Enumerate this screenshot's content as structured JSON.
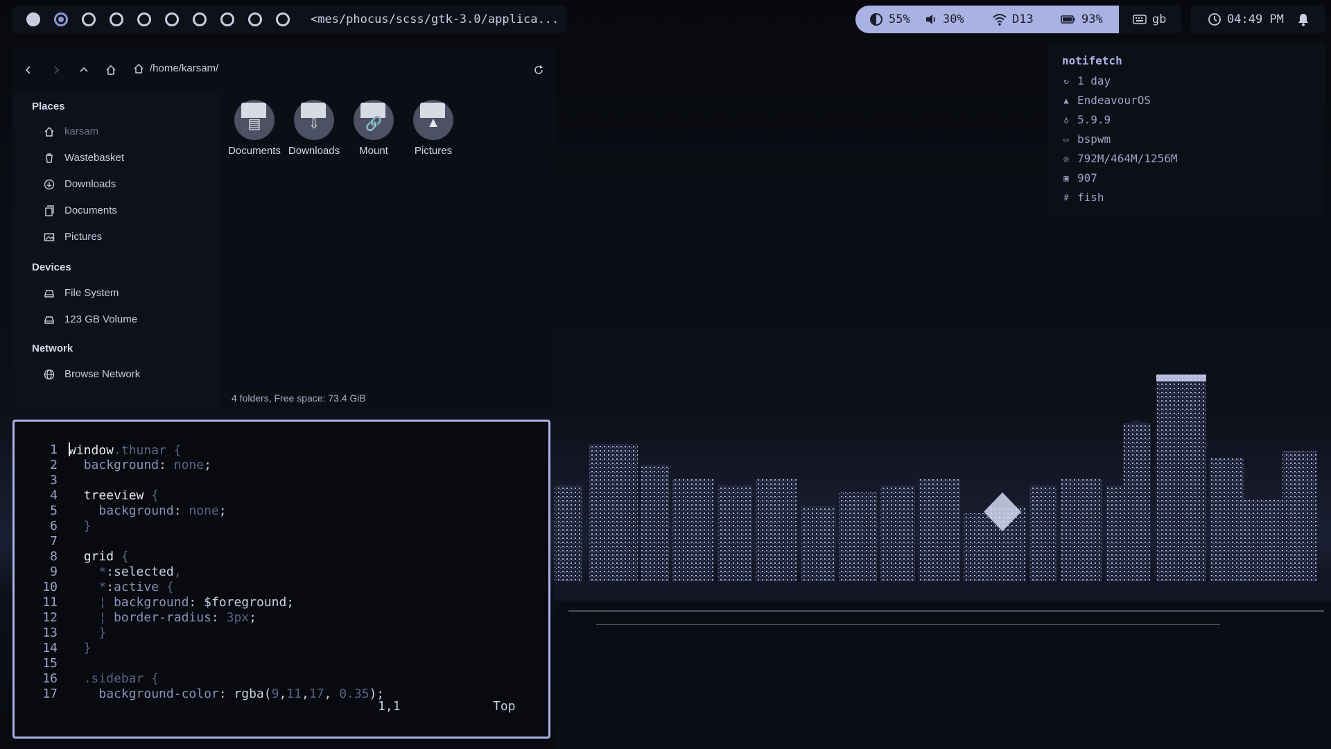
{
  "topbar": {
    "workspaces": [
      {
        "state": "filled"
      },
      {
        "state": "focused"
      },
      {
        "state": "empty"
      },
      {
        "state": "empty"
      },
      {
        "state": "empty"
      },
      {
        "state": "empty"
      },
      {
        "state": "empty"
      },
      {
        "state": "empty"
      },
      {
        "state": "empty"
      },
      {
        "state": "empty"
      }
    ],
    "window_title": "<mes/phocus/scss/gtk-3.0/applica...",
    "brightness": "55%",
    "volume": "30%",
    "wifi": "D13",
    "battery": "93%",
    "keyboard_layout": "gb",
    "clock": "04:49 PM",
    "status_bg": "#aab1e3"
  },
  "notifetch": {
    "title": "notifetch",
    "uptime": "1 day",
    "distro": "EndeavourOS",
    "kernel": "5.9.9",
    "wm": "bspwm",
    "memory": "792M/464M/1256M",
    "packages": "907",
    "shell": "fish"
  },
  "file_manager": {
    "path": "/home/karsam/",
    "sidebar": {
      "places_heading": "Places",
      "places": [
        {
          "label": "karsam",
          "icon": "home-icon",
          "current": true
        },
        {
          "label": "Wastebasket",
          "icon": "trash-icon"
        },
        {
          "label": "Downloads",
          "icon": "download-icon"
        },
        {
          "label": "Documents",
          "icon": "documents-icon"
        },
        {
          "label": "Pictures",
          "icon": "pictures-icon"
        }
      ],
      "devices_heading": "Devices",
      "devices": [
        {
          "label": "File System",
          "icon": "drive-icon"
        },
        {
          "label": "123 GB Volume",
          "icon": "drive-icon"
        }
      ],
      "network_heading": "Network",
      "network": [
        {
          "label": "Browse Network",
          "icon": "network-icon"
        }
      ]
    },
    "folders": [
      {
        "label": "Documents",
        "icon": "folder-documents-icon"
      },
      {
        "label": "Downloads",
        "icon": "folder-downloads-icon"
      },
      {
        "label": "Mount",
        "icon": "folder-link-icon"
      },
      {
        "label": "Pictures",
        "icon": "folder-pictures-icon"
      }
    ],
    "status": "4 folders, Free space: 73.4 GiB"
  },
  "editor": {
    "line_numbers": [
      "1",
      "2",
      "3",
      "4",
      "5",
      "6",
      "7",
      "8",
      "9",
      "10",
      "11",
      "12",
      "13",
      "14",
      "15",
      "16",
      "17"
    ],
    "cursor_position": "1,1",
    "scroll_position": "Top",
    "border_color": "#aab1e3"
  }
}
